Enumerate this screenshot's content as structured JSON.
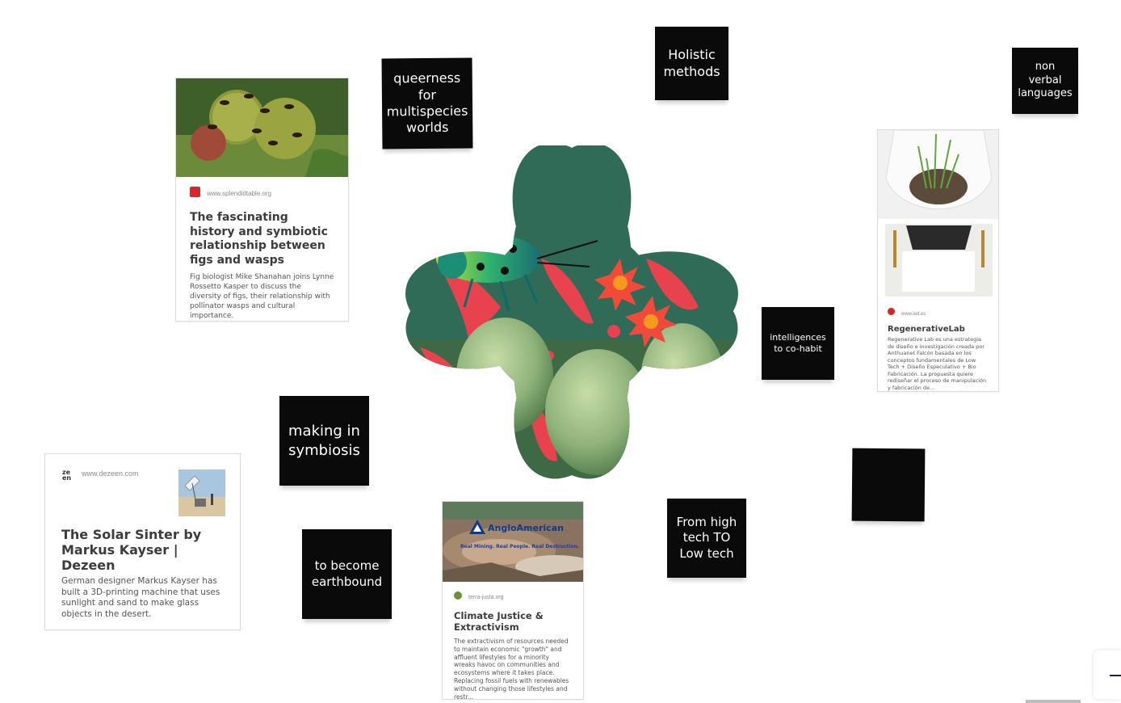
{
  "stickies": {
    "queerness": "queerness\nfor\nmultispecies\nworlds",
    "holistic": "Holistic\nmethods",
    "nonverbal": "non\nverbal\nlanguages",
    "intelligences": "intelligences\nto co-habit",
    "making": "making in\nsymbiosis",
    "earthbound": "to become\nearthbound",
    "lowtech": "From high\ntech TO\nLow tech",
    "blank": ""
  },
  "cards": {
    "figs": {
      "host": "www.splendidtable.org",
      "title": "The fascinating history and symbiotic relationship between figs and wasps",
      "desc": "Fig biologist Mike Shanahan joins Lynne Rossetto Kasper to discuss the diversity of figs, their relationship with pollinator wasps and cultural importance."
    },
    "regen": {
      "host": "www.ied.es",
      "title": "RegenerativeLab",
      "desc": "Regenerative Lab es una estrategia de diseño e investigación creada por Anthuanet Falcón basada en los conceptos fundamentales de Low Tech + Diseño Especulativo + Bio Fabricación. La propuesta quiere rediseñar el proceso de manipulación y fabricación de...",
      "image_caption": "..."
    },
    "solar": {
      "host": "www.dezeen.com",
      "logo": "ze\nen",
      "title": "The Solar Sinter by Markus Kayser | Dezeen",
      "desc": "German designer Markus Kayser has built a 3D-printing machine that uses sunlight and sand to make glass objects in the desert."
    },
    "climate": {
      "host": "terra-justa.org",
      "banner_brand": "AngloAmerican",
      "banner_tagline": "Real Mining. Real People. Real Destruction.",
      "title": "Climate Justice & Extractivism",
      "desc": "The extractivism of resources needed to maintain economic \"growth\" and affluent lifestyles for a minority wreaks havoc on communities and ecosystems where it takes place. Replacing fossil fuels with renewables without changing those lifestyles and restr..."
    }
  },
  "colors": {
    "sticky_bg": "#0a0a0a",
    "flower_bg": "#2f6b57",
    "blossom_red": "#e8424f"
  },
  "icons": {
    "flower": "flower-image",
    "zoom_out": "minus-icon"
  }
}
